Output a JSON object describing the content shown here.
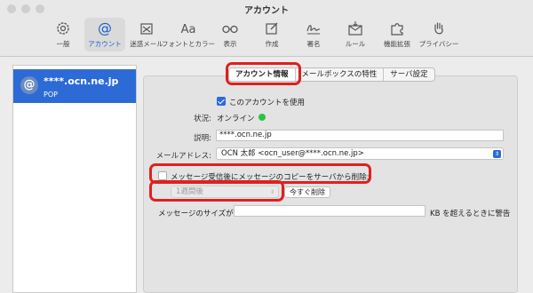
{
  "window": {
    "title": "アカウント"
  },
  "toolbar": {
    "items": [
      {
        "label": "一般",
        "icon": "gear-icon"
      },
      {
        "label": "アカウント",
        "icon": "at-icon",
        "active": true
      },
      {
        "label": "迷惑メール",
        "icon": "junk-icon"
      },
      {
        "label": "フォントとカラー",
        "icon": "font-icon"
      },
      {
        "label": "表示",
        "icon": "glasses-icon"
      },
      {
        "label": "作成",
        "icon": "compose-icon"
      },
      {
        "label": "署名",
        "icon": "signature-icon"
      },
      {
        "label": "ルール",
        "icon": "rules-icon"
      },
      {
        "label": "機能拡張",
        "icon": "extension-icon"
      },
      {
        "label": "プライバシー",
        "icon": "privacy-hand-icon"
      }
    ]
  },
  "sidebar": {
    "account": {
      "name": "****.ocn.ne.jp",
      "type": "POP",
      "icon_char": "@"
    }
  },
  "tabs": [
    {
      "label": "アカウント情報",
      "active": true
    },
    {
      "label": "メールボックスの特性"
    },
    {
      "label": "サーバ設定"
    }
  ],
  "form": {
    "enable_label": "このアカウントを使用",
    "status_label": "状況:",
    "status_value": "オンライン",
    "description_label": "説明:",
    "description_value": "****.ocn.ne.jp",
    "email_label": "メールアドレス:",
    "email_value": "OCN 太郎 <ocn_user@****.ocn.ne.jp>",
    "delete_label": "メッセージ受信後にメッセージのコピーをサーバから削除:",
    "delete_period": "1週間後",
    "delete_now_button": "今すぐ削除",
    "size_label": "メッセージのサイズが",
    "size_suffix": "KB を超えるときに警告"
  },
  "colors": {
    "accent": "#2c6bd6",
    "highlight": "#e11f1f",
    "status_online": "#2bc43e"
  }
}
